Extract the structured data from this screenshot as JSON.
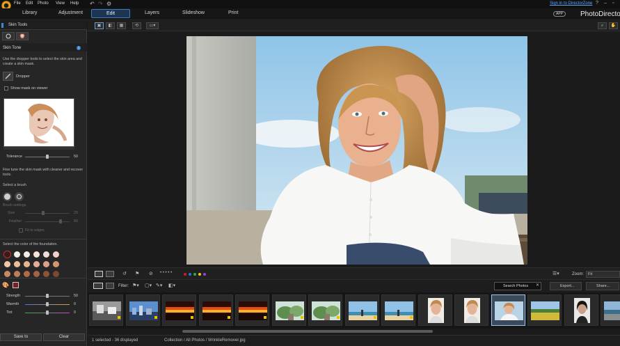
{
  "menubar": {
    "items": [
      "File",
      "Edit",
      "Photo",
      "View",
      "Help"
    ],
    "sign_in": "Sign in to DirectorZone",
    "help": "?"
  },
  "modes": {
    "library": "Library",
    "adjustment": "Adjustment",
    "edit": "Edit",
    "layers": "Layers",
    "slideshow": "Slideshow",
    "print": "Print",
    "app_badge": "APP",
    "brand": "PhotoDirector"
  },
  "left_panel": {
    "title": "Skin Tools",
    "section_title": "Skin Tone",
    "intro_text": "Use the dropper tools to select the skin area and create a skin mask.",
    "dropper_label": "Dropper",
    "show_mask_label": "Show mask on viewer",
    "tolerance": {
      "label": "Tolerance",
      "value": "50",
      "level": 0.5
    },
    "fine_tune_text": "Fine tune the skin mask with cleaner and recover tools.",
    "select_brush_label": "Select a brush",
    "brush_settings_label": "Brush settings",
    "size": {
      "label": "Size",
      "value": "20",
      "level": 0.4
    },
    "feather": {
      "label": "Feather",
      "value": "80",
      "level": 0.8
    },
    "fit_edges_label": "Fit to edges",
    "foundation_label": "Select the color of the foundation.",
    "swatch_colors": [
      [
        "#3a1a1a",
        "#f6f0ea",
        "#f7efe6",
        "#f6e6da",
        "#f3dcdc",
        "#f2d0d0"
      ],
      [
        "#f2c6a6",
        "#efbd96",
        "#e9b48a",
        "#e4ad9a",
        "#dba08a",
        "#d4966f"
      ],
      [
        "#c98a62",
        "#c07c58",
        "#b06a48",
        "#a46444",
        "#8e5236",
        "#7a4a30"
      ]
    ],
    "strength": {
      "label": "Strength",
      "value": "50",
      "level": 0.5
    },
    "warmth": {
      "label": "Warmth",
      "value": "0",
      "level": 0.5
    },
    "tint": {
      "label": "Tint",
      "value": "0",
      "level": 0.5
    },
    "save_label": "Save to",
    "clear_label": "Clear"
  },
  "view_toolbar": {
    "label_dots": "• • • • •",
    "color_labels": [
      "#d11f1f",
      "#2f6fd6",
      "#2fae3b",
      "#e3cc1b",
      "#9b3fd0"
    ],
    "zoom_label": "Zoom:",
    "zoom_value": "Fit"
  },
  "filter_toolbar": {
    "filter_label": "Filter:",
    "search_placeholder": "Search Photos",
    "export_label": "Export...",
    "share_label": "Share..."
  },
  "filmstrip": {
    "thumbs": [
      {
        "kind": "bw"
      },
      {
        "kind": "city"
      },
      {
        "kind": "sunset"
      },
      {
        "kind": "sunset"
      },
      {
        "kind": "sunset"
      },
      {
        "kind": "garden"
      },
      {
        "kind": "garden"
      },
      {
        "kind": "beach"
      },
      {
        "kind": "beach"
      },
      {
        "kind": "portrait"
      },
      {
        "kind": "portrait"
      },
      {
        "kind": "woman",
        "selected": true
      },
      {
        "kind": "field"
      },
      {
        "kind": "darkportrait"
      },
      {
        "kind": "coast"
      }
    ]
  },
  "statusbar": {
    "count": "1 selected - 36 displayed",
    "path": "Collection / All Photos / WrinkleRemover.jpg"
  }
}
